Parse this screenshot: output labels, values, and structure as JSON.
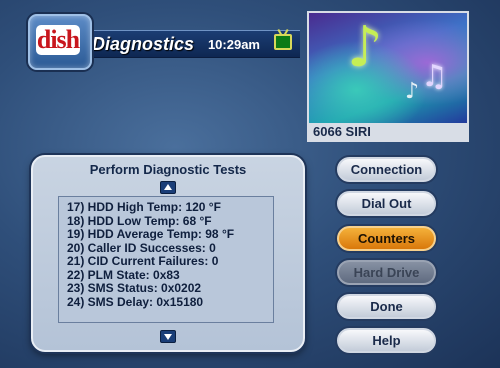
{
  "header": {
    "logo_text": "dish",
    "title": "Diagnostics",
    "clock": "10:29am",
    "tv_icon": "tv-icon"
  },
  "preview": {
    "channel_label": "6066 SIRI",
    "image": "music-notes"
  },
  "panel": {
    "title": "Perform Diagnostic Tests",
    "items": [
      "17) HDD High Temp: 120 °F",
      "18) HDD Low Temp: 68 °F",
      "19) HDD Average Temp: 98 °F",
      "20) Caller ID Successes: 0",
      "21) CID Current Failures: 0",
      "22) PLM State: 0x83",
      "23) SMS Status: 0x0202",
      "24) SMS Delay: 0x15180"
    ]
  },
  "buttons": {
    "connection": "Connection",
    "dial_out": "Dial Out",
    "counters": "Counters",
    "hard_drive": "Hard Drive",
    "done": "Done",
    "help": "Help"
  },
  "colors": {
    "background": "#2f4f7a",
    "active_button": "#e8921f",
    "panel": "#c2cfdf"
  }
}
